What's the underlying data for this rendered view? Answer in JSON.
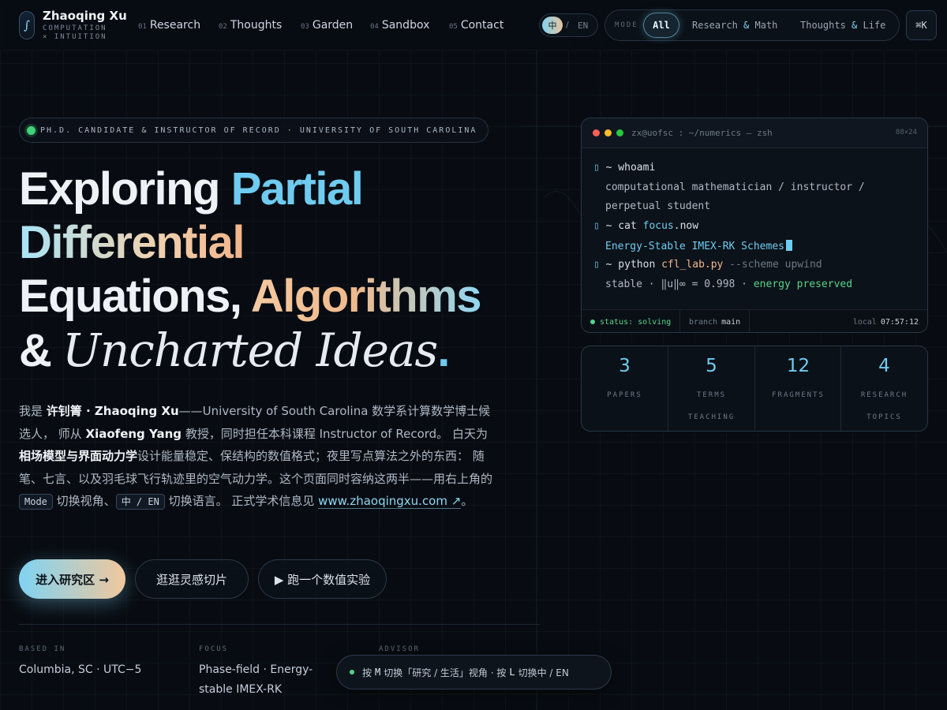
{
  "nav": {
    "brand_glyph": "∫",
    "brand_name": "Zhaoqing Xu",
    "brand_sub_1": "COMPUTATION",
    "brand_sub_2": "× INTUITION",
    "links": [
      {
        "num": "01",
        "label": "Research"
      },
      {
        "num": "02",
        "label": "Thoughts"
      },
      {
        "num": "03",
        "label": "Garden"
      },
      {
        "num": "04",
        "label": "Sandbox"
      },
      {
        "num": "05",
        "label": "Contact"
      }
    ],
    "lang": {
      "active": "中",
      "sep": "/",
      "other": "EN"
    },
    "mode": {
      "label": "MODE",
      "all": "All",
      "opt1_a": "Research",
      "opt1_amp": "&",
      "opt1_b": "Math",
      "opt2_a": "Thoughts",
      "opt2_amp": "&",
      "opt2_b": "Life"
    },
    "cmd": "⌘K"
  },
  "hero": {
    "badge": "PH.D. CANDIDATE & INSTRUCTOR OF RECORD · UNIVERSITY OF SOUTH CAROLINA",
    "h_exploring": "Exploring ",
    "h_partial": "Partial",
    "h_differential": "Differential",
    "h_equations": "Equations, ",
    "h_algorithms": "Algorithms",
    "h_amp": "& ",
    "h_uncharted": "Uncharted Ideas",
    "h_dot": ".",
    "intro": {
      "t1": "我是 ",
      "b1": "许钊箐 · Zhaoqing Xu",
      "t2": "——University of South Carolina 数学系计算数学博士候选人， 师从 ",
      "b2": "Xiaofeng Yang",
      "t3": " 教授，同时担任本科课程 Instructor of Record。 白天为",
      "b3": "相场模型与界面动力学",
      "t4": "设计能量稳定、保结构的数值格式；夜里写点算法之外的东西： 随笔、七言、以及羽毛球飞行轨迹里的空气动力学。这个页面同时容纳这两半——用右上角的 ",
      "k1": "Mode",
      "t5": " 切换视角、",
      "k2": "中 / EN",
      "t6": " 切换语言。 正式学术信息见 ",
      "link": "www.zhaoqingxu.com ↗",
      "t7": "。"
    },
    "buttons": {
      "primary": "进入研究区 →",
      "secondary": "逛逛灵感切片",
      "tertiary": "▶ 跑一个数值实验"
    },
    "meta": [
      {
        "label": "BASED IN",
        "value": "Columbia, SC · UTC−5"
      },
      {
        "label": "FOCUS",
        "value": "Phase-field · Energy-stable IMEX-RK"
      },
      {
        "label": "ADVISOR",
        "value": ""
      }
    ]
  },
  "terminal": {
    "title": "zx@uofsc : ~/numerics — zsh",
    "size": "88×24",
    "prompt_glyph": "▯",
    "lines": {
      "c1": "~ whoami",
      "o1a": "computational mathematician / instructor /",
      "o1b": "perpetual student",
      "c2_pre": "~ cat ",
      "c2_hl": "focus",
      "c2_post": ".now",
      "o2": "Energy-Stable IMEX-RK Schemes",
      "c3_pre": "~ python ",
      "c3_file": "cfl_lab.py",
      "c3_flag": " --scheme upwind",
      "o3_pre": "stable · ‖u‖∞ = 0.998 · ",
      "o3_ok": "energy preserved"
    },
    "footer": {
      "status": "status: solving",
      "branch_label": "branch",
      "branch": "main",
      "local_label": "local",
      "time": "07:57:12"
    }
  },
  "stats": [
    {
      "num": "3",
      "label": "PAPERS"
    },
    {
      "num": "5",
      "label": "TERMS TEACHING"
    },
    {
      "num": "12",
      "label": "FRAGMENTS"
    },
    {
      "num": "4",
      "label": "RESEARCH TOPICS"
    }
  ],
  "hint": {
    "t1": "按",
    "k1": "M",
    "t2": "切换「研究 / 生活」视角 · 按",
    "k2": "L",
    "t3": "切换中 / EN"
  },
  "colors": {
    "accent_blue": "#6fcbf0",
    "accent_warm": "#f0b98c",
    "status_green": "#57d48a",
    "background": "#080c12"
  }
}
